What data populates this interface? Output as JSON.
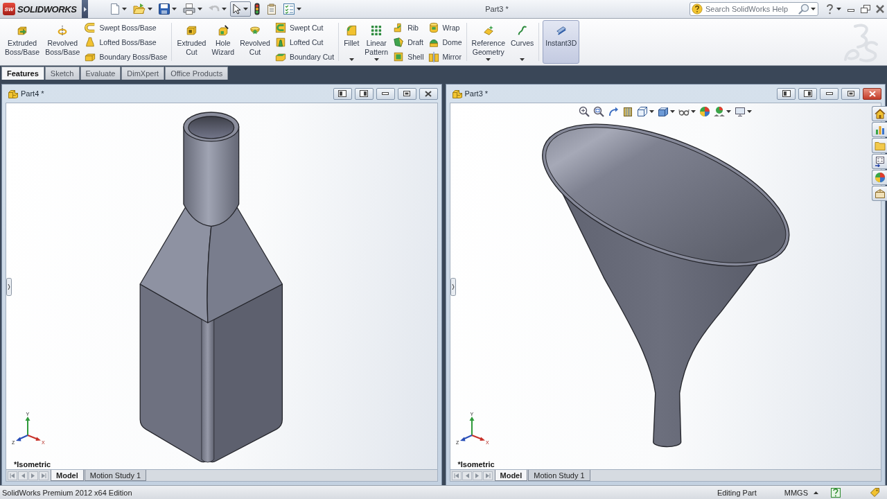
{
  "title_bar": {
    "logo": {
      "badge": "SW",
      "wordmark": "SOLIDWORKS"
    },
    "quick_access": [
      {
        "kind": "new",
        "dropdown": true,
        "selected": false,
        "disabled": false
      },
      {
        "kind": "open",
        "dropdown": true,
        "selected": false,
        "disabled": false
      },
      {
        "kind": "save",
        "dropdown": true,
        "selected": false,
        "disabled": false
      },
      {
        "kind": "print",
        "dropdown": true,
        "selected": false,
        "disabled": false
      },
      {
        "kind": "undo",
        "dropdown": true,
        "selected": false,
        "disabled": true
      },
      {
        "kind": "select",
        "dropdown": true,
        "selected": true,
        "disabled": false
      },
      {
        "kind": "rebuild",
        "dropdown": false,
        "selected": false,
        "disabled": false
      },
      {
        "kind": "properties",
        "dropdown": false,
        "selected": false,
        "disabled": false
      },
      {
        "kind": "options",
        "dropdown": true,
        "selected": false,
        "disabled": false
      }
    ],
    "title": "Part3 *",
    "search": {
      "placeholder": "Search SolidWorks Help"
    }
  },
  "command_manager": {
    "groups": [
      {
        "commands": [
          {
            "kind": "large",
            "label": "Extruded Boss/Base",
            "dropdown": false,
            "selected": false
          },
          {
            "kind": "large",
            "label": "Revolved Boss/Base",
            "dropdown": false,
            "selected": false
          },
          {
            "kind": "stack",
            "items": [
              {
                "label": "Swept Boss/Base"
              },
              {
                "label": "Lofted Boss/Base"
              },
              {
                "label": "Boundary Boss/Base"
              }
            ]
          }
        ]
      },
      {
        "commands": [
          {
            "kind": "large",
            "label": "Extruded Cut",
            "dropdown": false,
            "selected": false
          },
          {
            "kind": "large",
            "label": "Hole Wizard",
            "dropdown": false,
            "selected": false
          },
          {
            "kind": "large",
            "label": "Revolved Cut",
            "dropdown": false,
            "selected": false
          },
          {
            "kind": "stack",
            "items": [
              {
                "label": "Swept Cut"
              },
              {
                "label": "Lofted Cut"
              },
              {
                "label": "Boundary Cut"
              }
            ]
          }
        ]
      },
      {
        "commands": [
          {
            "kind": "large",
            "label": "Fillet",
            "dropdown": true,
            "selected": false
          },
          {
            "kind": "large",
            "label": "Linear Pattern",
            "dropdown": true,
            "selected": false
          },
          {
            "kind": "stack",
            "items": [
              {
                "label": "Rib"
              },
              {
                "label": "Draft"
              },
              {
                "label": "Shell"
              }
            ]
          },
          {
            "kind": "stack",
            "items": [
              {
                "label": "Wrap"
              },
              {
                "label": "Dome"
              },
              {
                "label": "Mirror"
              }
            ]
          }
        ]
      },
      {
        "commands": [
          {
            "kind": "large",
            "label": "Reference Geometry",
            "dropdown": true,
            "selected": false
          },
          {
            "kind": "large",
            "label": "Curves",
            "dropdown": true,
            "selected": false
          }
        ]
      },
      {
        "commands": [
          {
            "kind": "large",
            "label": "Instant3D",
            "dropdown": false,
            "selected": true
          }
        ]
      }
    ],
    "tabs": [
      {
        "label": "Features",
        "selected": true
      },
      {
        "label": "Sketch",
        "selected": false
      },
      {
        "label": "Evaluate",
        "selected": false
      },
      {
        "label": "DimXpert",
        "selected": false
      },
      {
        "label": "Office Products",
        "selected": false
      }
    ]
  },
  "documents": [
    {
      "kind": "bottle",
      "title": "Part4 *",
      "active": false,
      "axis_labels": {
        "x": "X",
        "y": "Y",
        "z": "Z"
      },
      "view_label": "*Isometric",
      "tabs": [
        {
          "label": "Model",
          "selected": true
        },
        {
          "label": "Motion Study 1",
          "selected": false
        }
      ]
    },
    {
      "kind": "funnel",
      "title": "Part3 *",
      "active": true,
      "axis_labels": {
        "x": "X",
        "y": "Y",
        "z": "Z"
      },
      "view_label": "*Isometric",
      "tabs": [
        {
          "label": "Model",
          "selected": true
        },
        {
          "label": "Motion Study 1",
          "selected": false
        }
      ]
    }
  ],
  "status_bar": {
    "edition": "SolidWorks Premium 2012 x64 Edition",
    "mode": "Editing Part",
    "units": "MMGS"
  }
}
